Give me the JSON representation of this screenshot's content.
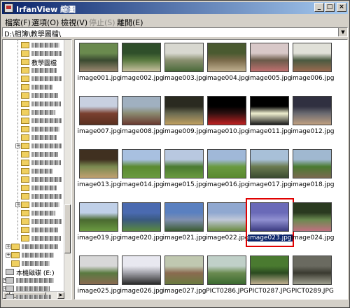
{
  "window": {
    "title": "IrfanView 縮圖",
    "buttons": [
      "_",
      "□",
      "×"
    ]
  },
  "menu": [
    {
      "label": "檔案(F)",
      "enabled": true
    },
    {
      "label": "選項(O)",
      "enabled": true
    },
    {
      "label": "檢視(V)",
      "enabled": true
    },
    {
      "label": "停止(S)",
      "enabled": false
    },
    {
      "label": "離開(E)",
      "enabled": true
    }
  ],
  "address": {
    "path": "D:\\相簿\\教學圖檔\\"
  },
  "tree": {
    "folder_label": "教學圖檔",
    "drive_label": "本機磁碟 (E:)"
  },
  "thumbnails": [
    {
      "name": "image001.jpg",
      "colors": [
        "#6a8a4e",
        "#9a8870",
        "#3a4a30"
      ]
    },
    {
      "name": "image002.jpg",
      "colors": [
        "#2f4f2a",
        "#c8c0a0",
        "#5a7a40"
      ]
    },
    {
      "name": "image003.jpg",
      "colors": [
        "#d8d8d0",
        "#4a6a3a",
        "#8a9070"
      ]
    },
    {
      "name": "image004.jpg",
      "colors": [
        "#4a5a30",
        "#c0b090",
        "#7a6a4a"
      ]
    },
    {
      "name": "image005.jpg",
      "colors": [
        "#d8c8c8",
        "#c07070",
        "#6a5a4a"
      ]
    },
    {
      "name": "image006.jpg",
      "colors": [
        "#e0e0d8",
        "#9a6a50",
        "#4a5a40"
      ]
    },
    {
      "name": "image007.jpg",
      "colors": [
        "#c8d0e0",
        "#5a3020",
        "#7a4030"
      ]
    },
    {
      "name": "image008.jpg",
      "colors": [
        "#a0b0c0",
        "#6a3a30",
        "#8a8a70"
      ]
    },
    {
      "name": "image009.jpg",
      "colors": [
        "#2a2a20",
        "#c0a060",
        "#6a6a50"
      ]
    },
    {
      "name": "image010.jpg",
      "colors": [
        "#000000",
        "#c02020",
        "#301010"
      ]
    },
    {
      "name": "image011.jpg",
      "colors": [
        "#000000",
        "#1a1a1a",
        "#f0f0d0"
      ]
    },
    {
      "name": "image012.jpg",
      "colors": [
        "#303040",
        "#c0a080",
        "#6a6a70"
      ]
    },
    {
      "name": "image013.jpg",
      "colors": [
        "#403020",
        "#c0a070",
        "#7a8a50"
      ]
    },
    {
      "name": "image014.jpg",
      "colors": [
        "#a8c0e0",
        "#6a9a40",
        "#5a8a30"
      ]
    },
    {
      "name": "image015.jpg",
      "colors": [
        "#b8c8e0",
        "#6a9a40",
        "#4a7a30"
      ]
    },
    {
      "name": "image016.jpg",
      "colors": [
        "#a0b8d8",
        "#5a8a30",
        "#6a9a40"
      ]
    },
    {
      "name": "image017.jpg",
      "colors": [
        "#a8c0d8",
        "#3a4a30",
        "#6a7a50"
      ]
    },
    {
      "name": "image018.jpg",
      "colors": [
        "#a0b8d0",
        "#7a6a50",
        "#4a7a30"
      ]
    },
    {
      "name": "image019.jpg",
      "colors": [
        "#c0d0e8",
        "#6a9a40",
        "#4a6a30"
      ]
    },
    {
      "name": "image020.jpg",
      "colors": [
        "#4a6ab0",
        "#5a8a40",
        "#3a5a80"
      ]
    },
    {
      "name": "image021.jpg",
      "colors": [
        "#5a80c0",
        "#3a5a30",
        "#8090b0"
      ]
    },
    {
      "name": "image022.jpg",
      "colors": [
        "#90a8d0",
        "#6a8a40",
        "#c0c8d8"
      ]
    },
    {
      "name": "image023.jpg",
      "colors": [
        "#6a6ab8",
        "#3a3a80",
        "#9090d0"
      ],
      "selected": true
    },
    {
      "name": "image024.jpg",
      "colors": [
        "#2a3a20",
        "#c07080",
        "#6a8a50"
      ]
    },
    {
      "name": "image025.jpg",
      "colors": [
        "#d8d8d8",
        "#8a6a50",
        "#5a7a40"
      ]
    },
    {
      "name": "image026.jpg",
      "colors": [
        "#e8e8f0",
        "#2a2a2a",
        "#a0a0a8"
      ]
    },
    {
      "name": "image027.jpg",
      "colors": [
        "#c0c8b0",
        "#6a7a40",
        "#8a6a50"
      ]
    },
    {
      "name": "PICT0286.JPG",
      "colors": [
        "#c0d0c8",
        "#3a6a30",
        "#6a8a50"
      ]
    },
    {
      "name": "PICT0287.JPG",
      "colors": [
        "#4a7a30",
        "#c0b090",
        "#2a4a20"
      ]
    },
    {
      "name": "PICT0289.JPG",
      "colors": [
        "#6a6a60",
        "#a0a090",
        "#3a3a30"
      ]
    }
  ]
}
